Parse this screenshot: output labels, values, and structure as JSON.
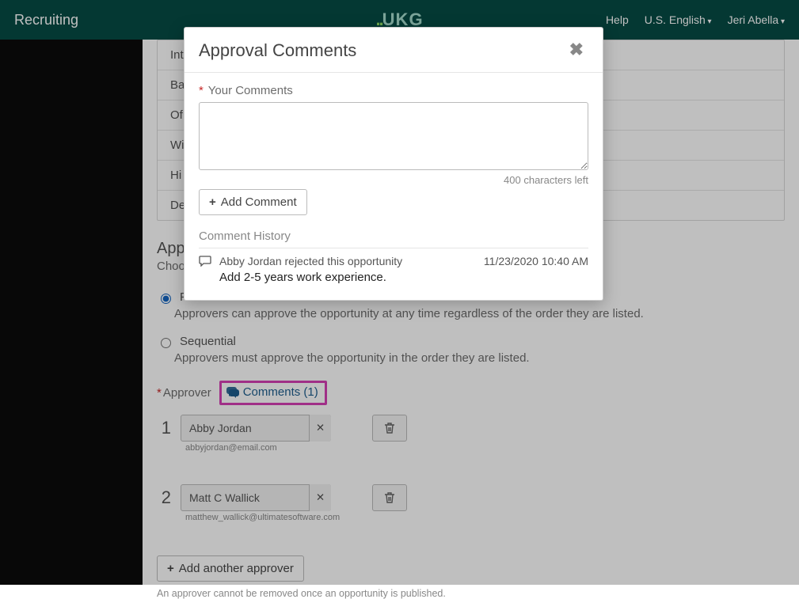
{
  "header": {
    "app": "Recruiting",
    "logo_text": "UKG",
    "help": "Help",
    "lang": "U.S. English",
    "user": "Jeri Abella"
  },
  "stages": [
    "Int",
    "Ba",
    "Of",
    "Wi",
    "Hi",
    "De"
  ],
  "approvals": {
    "title": "App",
    "desc": "Choo",
    "parallel_label": "Pa",
    "parallel_hint": "Approvers can approve the opportunity at any time regardless of the order they are listed.",
    "sequential_label": "Sequential",
    "sequential_hint": "Approvers must approve the opportunity in the order they are listed.",
    "approver_label": "Approver",
    "comments_link": "Comments (1)",
    "approvers": [
      {
        "num": "1",
        "name": "Abby Jordan",
        "email": "abbyjordan@email.com"
      },
      {
        "num": "2",
        "name": "Matt C Wallick",
        "email": "matthew_wallick@ultimatesoftware.com"
      }
    ],
    "add_another": "Add another approver",
    "footnote": "An approver cannot be removed once an opportunity is published."
  },
  "modal": {
    "title": "Approval Comments",
    "your_comments": "Your Comments",
    "char_left": "400 characters left",
    "add_comment": "Add Comment",
    "history_title": "Comment History",
    "history": {
      "action": "Abby Jordan rejected this opportunity",
      "timestamp": "11/23/2020 10:40 AM",
      "body": "Add 2-5 years work experience."
    }
  }
}
